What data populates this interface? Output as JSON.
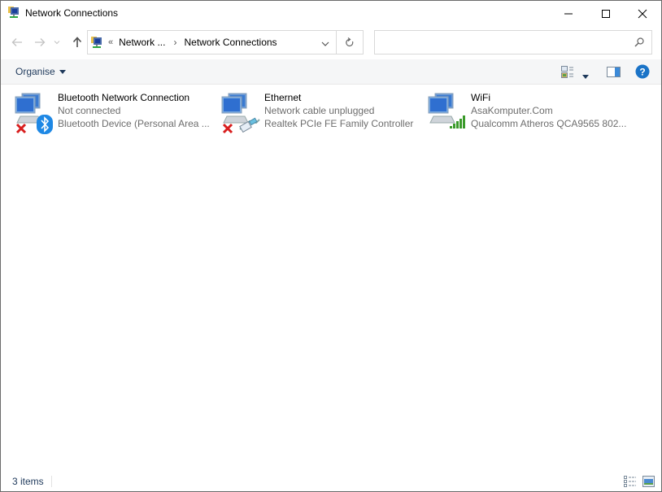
{
  "window": {
    "title": "Network Connections",
    "controls": {
      "minimize": "minimize",
      "maximize": "maximize",
      "close": "close"
    }
  },
  "navigation": {
    "back": "Back",
    "forward": "Forward",
    "recent": "Recent locations",
    "up": "Up",
    "breadcrumb": {
      "overflow": "«",
      "parent": "Network ...",
      "separator": "›",
      "current": "Network Connections"
    },
    "search": {
      "placeholder": "",
      "value": ""
    }
  },
  "commandbar": {
    "organise_label": "Organise",
    "view_options": "Change your view",
    "preview_pane": "Show the preview pane",
    "help": "?"
  },
  "connections": [
    {
      "name": "Bluetooth Network Connection",
      "status": "Not connected",
      "device": "Bluetooth Device (Personal Area ...",
      "overlay": "bluetooth",
      "disconnected": true
    },
    {
      "name": "Ethernet",
      "status": "Network cable unplugged",
      "device": "Realtek PCIe FE Family Controller",
      "overlay": "ethernet",
      "disconnected": true
    },
    {
      "name": "WiFi",
      "status": "AsaKomputer.Com",
      "device": "Qualcomm Atheros QCA9565 802...",
      "overlay": "wifi-signal",
      "disconnected": false
    }
  ],
  "statusbar": {
    "item_count": "3 items"
  },
  "colors": {
    "accent": "#1e395b",
    "help_blue": "#1a73c7",
    "error_red": "#d81e1e",
    "signal_green": "#3a9a2a",
    "bluetooth_blue": "#1e88e5"
  }
}
